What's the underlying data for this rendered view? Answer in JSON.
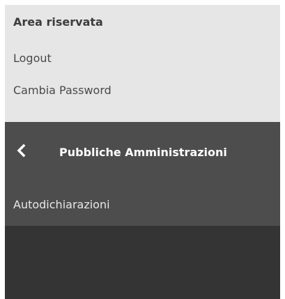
{
  "reserved_area": {
    "title": "Area riservata",
    "logout_label": "Logout",
    "change_password_label": "Cambia Password"
  },
  "navigation": {
    "back_icon": "chevron-left-icon",
    "title": "Pubbliche Amministrazioni",
    "items": [
      {
        "label": "Autodichiarazioni"
      }
    ]
  },
  "colors": {
    "top_panel_bg": "#e6e6e6",
    "nav_panel_bg": "#4d4d4d",
    "bottom_panel_bg": "#343434",
    "nav_text": "#ffffff"
  }
}
